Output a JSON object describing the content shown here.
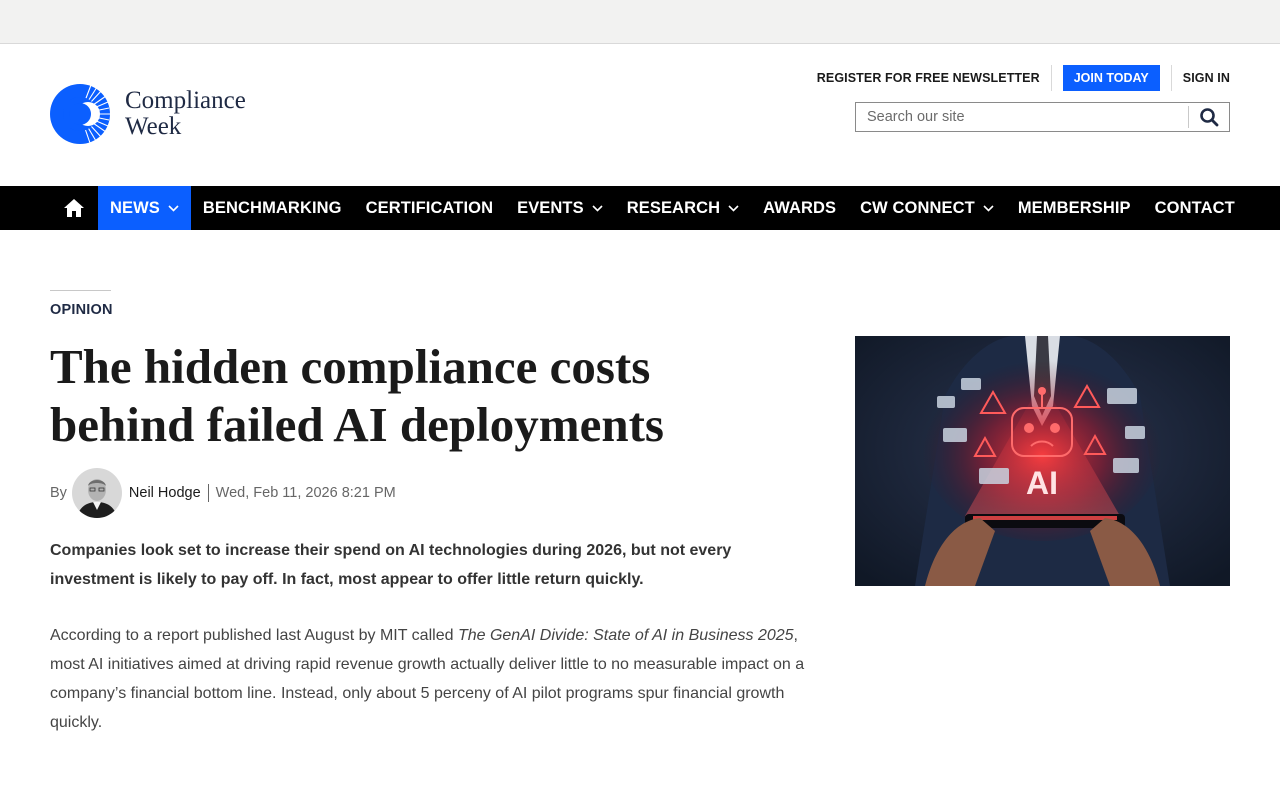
{
  "brand": {
    "line1": "Compliance",
    "line2": "Week",
    "color": "#0b5fff"
  },
  "utility": {
    "newsletter": "REGISTER FOR FREE NEWSLETTER",
    "join": "JOIN TODAY",
    "signin": "SIGN IN"
  },
  "search": {
    "placeholder": "Search our site",
    "icon": "search-icon"
  },
  "nav": {
    "home_icon": "home-icon",
    "items": [
      {
        "label": "NEWS",
        "dropdown": true,
        "active": true
      },
      {
        "label": "BENCHMARKING"
      },
      {
        "label": "CERTIFICATION"
      },
      {
        "label": "EVENTS",
        "dropdown": true
      },
      {
        "label": "RESEARCH",
        "dropdown": true
      },
      {
        "label": "AWARDS"
      },
      {
        "label": "CW CONNECT",
        "dropdown": true
      },
      {
        "label": "MEMBERSHIP"
      },
      {
        "label": "CONTACT"
      }
    ]
  },
  "article": {
    "kicker": "OPINION",
    "headline": "The hidden compliance costs behind failed AI deployments",
    "by": "By",
    "author": "Neil Hodge",
    "date": "Wed, Feb 11, 2026 8:21 PM",
    "standfirst": "Companies look set to increase their spend on AI technologies during 2026, but not every investment is likely to pay off. In fact, most appear to offer little return quickly.",
    "body": {
      "before": "According to a report published last August by MIT called ",
      "title": "The GenAI Divide: State of AI in Business 2025",
      "after": ", most AI initiatives aimed at driving rapid revenue growth actually deliver little to no measurable impact on a company’s financial bottom line. Instead, only about 5 perceny of AI pilot programs spur financial growth quickly."
    },
    "hero_text": "AI"
  },
  "colors": {
    "accent": "#0b5fff",
    "nav_bg": "#000000",
    "top_strip": "#f2f2f1"
  }
}
